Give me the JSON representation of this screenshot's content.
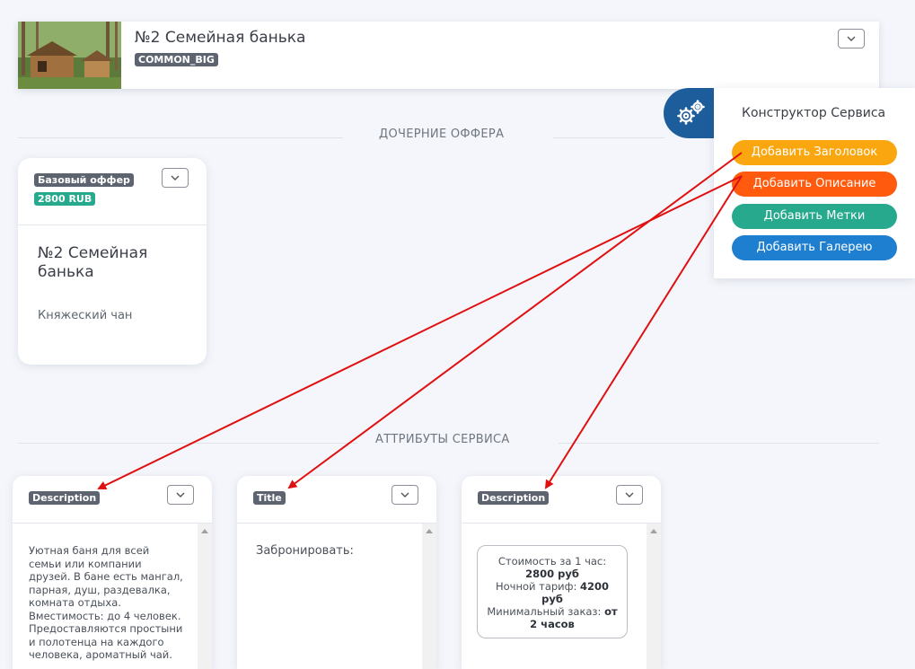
{
  "service": {
    "title": "№2 Семейная банька",
    "badge": "COMMON_BIG"
  },
  "sections": {
    "child_offers": "ДОЧЕРНИЕ ОФФЕРА",
    "service_attributes": "АТТРИБУТЫ СЕРВИСА"
  },
  "offer": {
    "type_badge": "Базовый оффер",
    "price_badge": "2800 RUB",
    "title": "№2 Семейная банька",
    "subtitle": "Княжеский чан"
  },
  "attributes": [
    {
      "badge": "Description",
      "text": "Уютная баня для всей семьи или компании друзей. В бане есть мангал, парная, душ, раздевалка, комната отдыха. Вместимость: до 4 человек. Предоставляются простыни и полотенца на каждого человека, ароматный чай."
    },
    {
      "badge": "Title",
      "text": "Забронировать:"
    },
    {
      "badge": "Description",
      "lines": [
        {
          "label": "Стоимость за 1 час: ",
          "value": "2800 руб"
        },
        {
          "label": "Ночной тариф: ",
          "value": "4200 руб"
        },
        {
          "label": "Минимальный заказ: ",
          "value": "от 2 часов"
        }
      ]
    }
  ],
  "constructor": {
    "title": "Конструктор Сервиса",
    "buttons": [
      {
        "label": "Добавить Заголовок",
        "color": "#f9a60f"
      },
      {
        "label": "Добавить Описание",
        "color": "#ff5a0d"
      },
      {
        "label": "Добавить Метки",
        "color": "#26a98c"
      },
      {
        "label": "Добавить Галерею",
        "color": "#1e7fd1"
      }
    ]
  },
  "colors": {
    "accent_blue": "#1e5d9c",
    "arrow_red": "#e01010"
  }
}
